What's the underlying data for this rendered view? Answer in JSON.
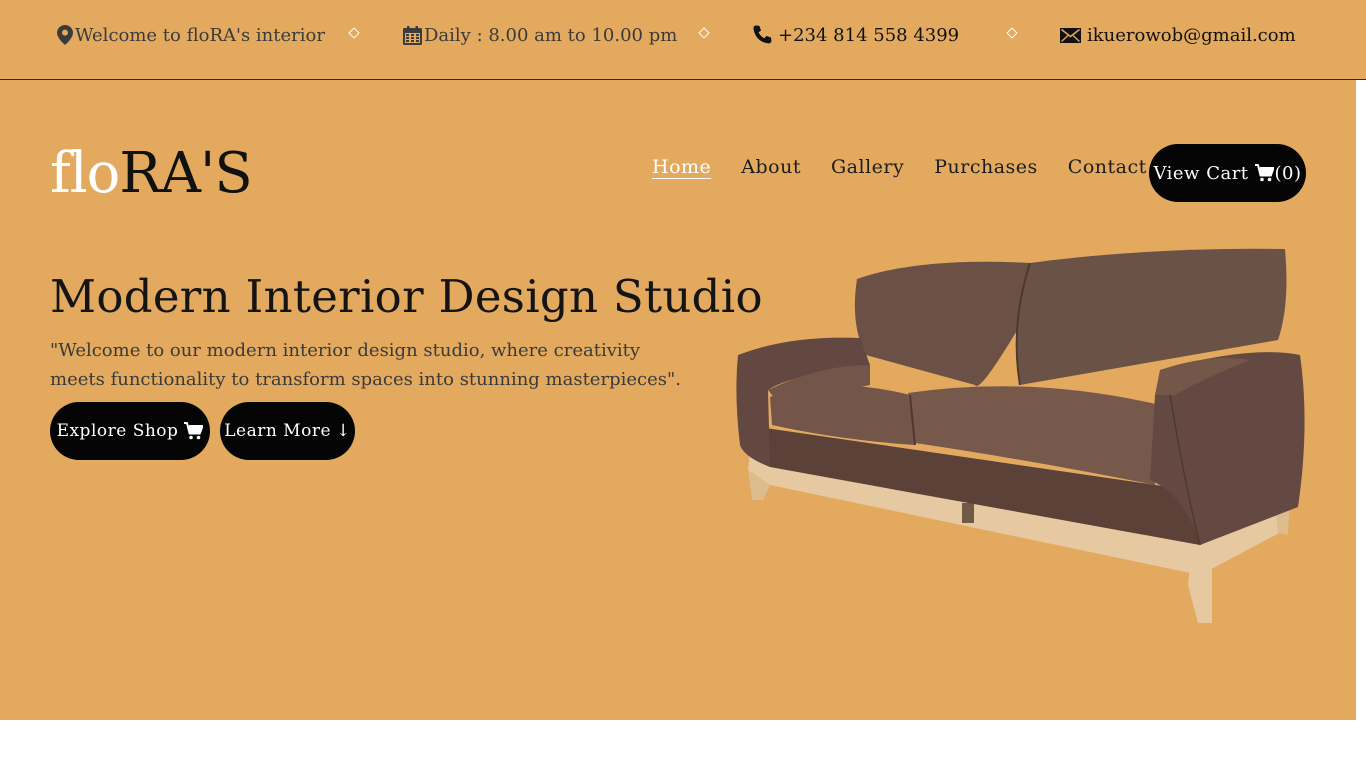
{
  "topbar": {
    "welcome": "Welcome to floRA's interior",
    "hours": "Daily : 8.00 am to 10.00 pm",
    "phone": "+234 814 558 4399",
    "email": "ikuerowob@gmail.com",
    "icons": [
      "map-marker-icon",
      "calendar-icon",
      "phone-icon",
      "envelope-icon"
    ]
  },
  "logo": {
    "part1": "flo",
    "part2": "RA'S"
  },
  "nav": {
    "items": [
      {
        "label": "Home",
        "active": true
      },
      {
        "label": "About"
      },
      {
        "label": "Gallery"
      },
      {
        "label": "Purchases"
      },
      {
        "label": "Contact"
      }
    ]
  },
  "cart": {
    "label": "View Cart",
    "count": "(0)",
    "icon": "cart-icon"
  },
  "hero": {
    "title": "Modern Interior Design Studio",
    "tagline": "\"Welcome to our modern interior design studio, where creativity meets functionality to transform spaces into stunning masterpieces\".",
    "explore_label": "Explore Shop",
    "learn_label": "Learn More",
    "learn_arrow": "↓"
  },
  "colors": {
    "background": "#e3a95e",
    "button": "#050505",
    "accent_text": "#ffffff",
    "sofa_fabric": "#6a5045",
    "sofa_wood": "#e6c9a0"
  }
}
